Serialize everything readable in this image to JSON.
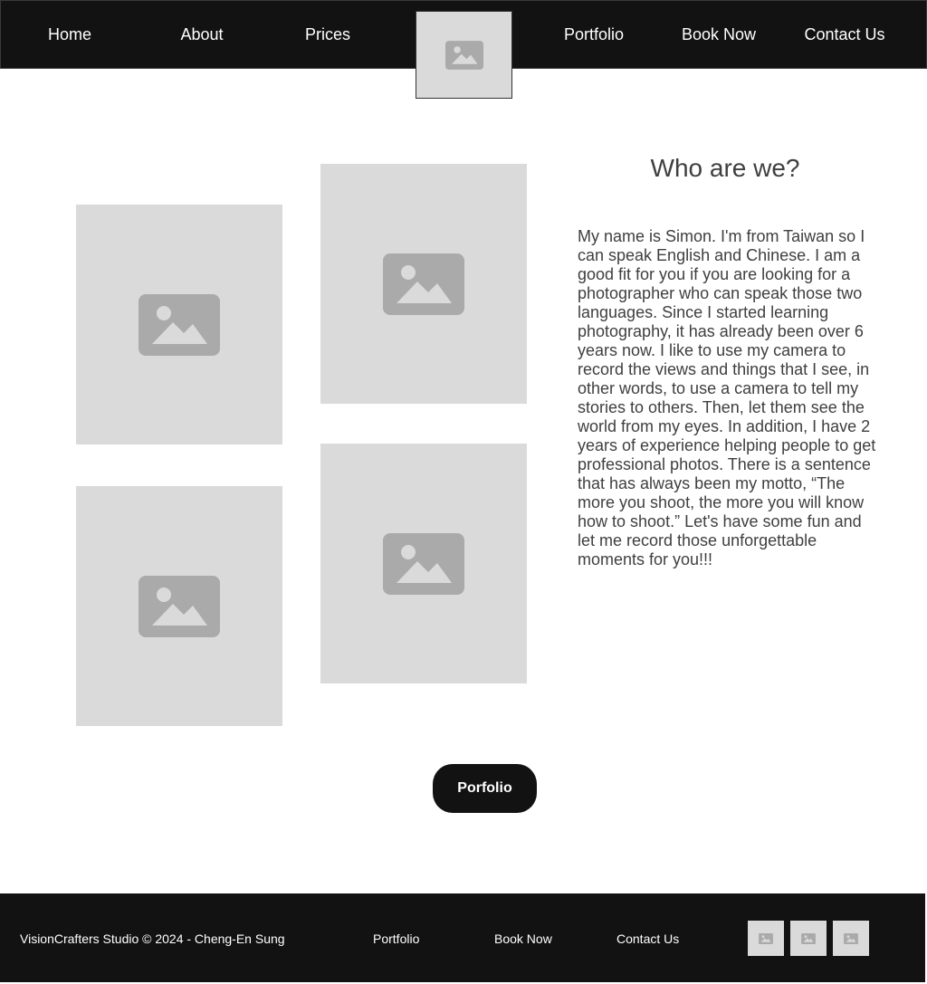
{
  "nav": {
    "items": [
      "Home",
      "About",
      "Prices",
      "Portfolio",
      "Book Now",
      "Contact Us"
    ],
    "logo_icon": "image-placeholder-icon"
  },
  "about": {
    "heading": "Who are we?",
    "body": "My name is Simon. I'm from Taiwan so I can speak English and Chinese. I am a good fit for you if you are looking for a photographer who can speak those two languages. Since I started learning photography, it has already been over 6 years now. I like to use my camera to record the views and things that I see, in other words, to use a camera to tell my stories to others. Then, let them see the world from my eyes. In addition, I have 2 years of experience helping people to get professional photos. There is a sentence that has always been my motto, “The more you shoot, the more you will know how to shoot.” Let's have some fun and let me record those unforgettable moments for you!!!"
  },
  "gallery": {
    "images": [
      "image-placeholder-icon",
      "image-placeholder-icon",
      "image-placeholder-icon",
      "image-placeholder-icon"
    ]
  },
  "cta": {
    "label": "Porfolio"
  },
  "footer": {
    "copyright": "VisionCrafters Studio © 2024 - Cheng-En Sung",
    "links": [
      "Portfolio",
      "Book Now",
      "Contact Us"
    ],
    "social_icons": [
      "image-placeholder-icon",
      "image-placeholder-icon",
      "image-placeholder-icon"
    ]
  },
  "colors": {
    "dark": "#121212",
    "placeholder_bg": "#dadada",
    "placeholder_icon": "#aaaaaa",
    "text": "#3f3f3f",
    "white": "#ffffff"
  }
}
